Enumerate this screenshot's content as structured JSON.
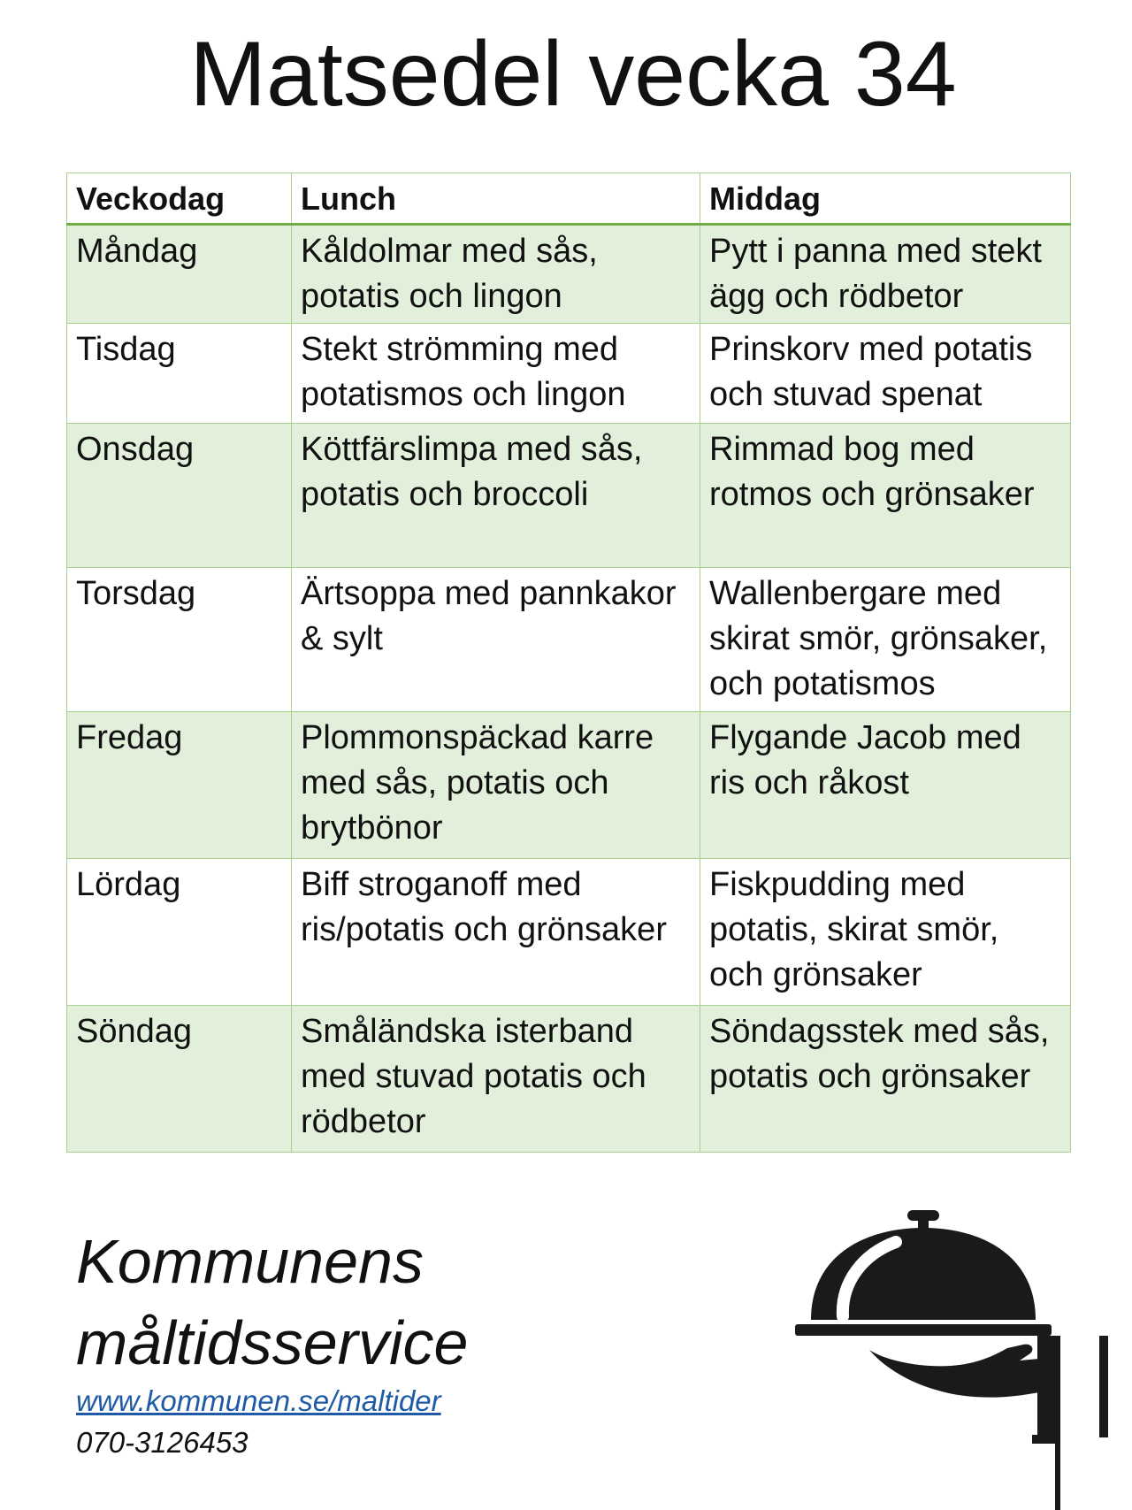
{
  "title": "Matsedel vecka 34",
  "table": {
    "headers": [
      "Veckodag",
      "Lunch",
      "Middag"
    ],
    "rows": [
      {
        "day": "Måndag",
        "lunch": "Kåldolmar med sås, potatis och lingon",
        "dinner": "Pytt i panna med stekt ägg och rödbetor"
      },
      {
        "day": "Tisdag",
        "lunch": "Stekt strömming med potatismos och lingon",
        "dinner": "Prinskorv med potatis och stuvad spenat"
      },
      {
        "day": "Onsdag",
        "lunch": "Köttfärslimpa med sås, potatis och broccoli",
        "dinner": "Rimmad bog med rotmos och grönsaker"
      },
      {
        "day": "Torsdag",
        "lunch": "Ärtsoppa med pannkakor & sylt",
        "dinner": "Wallenbergare med skirat smör, grönsaker, och potatismos"
      },
      {
        "day": "Fredag",
        "lunch": "Plommonspäckad karre med sås, potatis och brytbönor",
        "dinner": "Flygande Jacob med ris och råkost"
      },
      {
        "day": "Lördag",
        "lunch": "Biff stroganoff med ris/potatis och grönsaker",
        "dinner": "Fiskpudding med potatis, skirat smör, och grönsaker"
      },
      {
        "day": "Söndag",
        "lunch": "Småländska isterband med stuvad potatis och rödbetor",
        "dinner": "Söndagsstek med sås, potatis och grönsaker"
      }
    ]
  },
  "footer": {
    "service_line1": "Kommunens",
    "service_line2": "måltidsservice",
    "link": "www.kommunen.se/maltider",
    "phone": "070-3126453"
  },
  "icon": "serving-cloche-icon",
  "colors": {
    "border": "#a9d18e",
    "header_rule": "#70ad47",
    "shaded_row": "#e2efda",
    "link": "#1f5aa6"
  }
}
